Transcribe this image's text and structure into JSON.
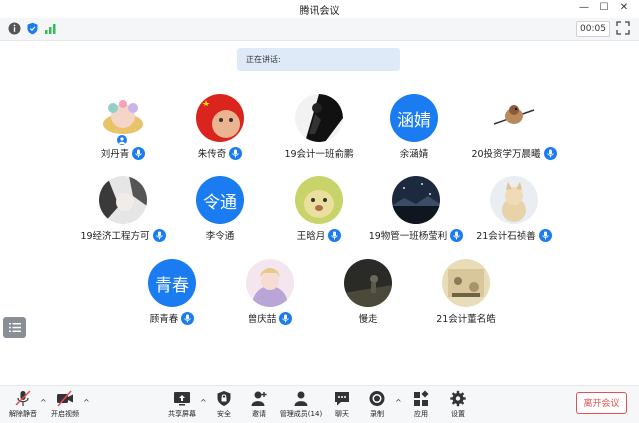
{
  "window": {
    "title": "腾讯会议",
    "minimize_glyph": "—",
    "maximize_glyph": "☐",
    "close_glyph": "✕"
  },
  "status": {
    "timer": "00:05",
    "speaking_label": "正在讲话:"
  },
  "colors": {
    "accent": "#1a7cf0",
    "leave_red": "#e94e4e",
    "speaking_bg": "#dfeaf8"
  },
  "participants": [
    {
      "name": "刘丹青",
      "avatar_type": "image",
      "host": true
    },
    {
      "name": "朱传奇",
      "avatar_type": "image",
      "host": false
    },
    {
      "name": "19会计一班俞鹏",
      "avatar_type": "image",
      "host": false
    },
    {
      "name": "余涵婧",
      "avatar_type": "text",
      "avatar_text": "涵婧",
      "host": false
    },
    {
      "name": "20投资学万晨曦",
      "avatar_type": "image",
      "host": false
    },
    {
      "name": "19经济工程方可",
      "avatar_type": "image",
      "host": false
    },
    {
      "name": "李令通",
      "avatar_type": "text",
      "avatar_text": "令通",
      "host": false
    },
    {
      "name": "王晗月",
      "avatar_type": "image",
      "host": false
    },
    {
      "name": "19物管一班杨莹利",
      "avatar_type": "image",
      "host": false
    },
    {
      "name": "21会计石祯善",
      "avatar_type": "image",
      "host": false
    },
    {
      "name": "顾青春",
      "avatar_type": "text",
      "avatar_text": "青春",
      "host": false
    },
    {
      "name": "曾庆喆",
      "avatar_type": "image",
      "host": false
    },
    {
      "name": "慢走",
      "avatar_type": "image",
      "host": false
    },
    {
      "name": "21会计董名皓",
      "avatar_type": "image",
      "host": false
    }
  ],
  "toolbar": {
    "unmute": "解除静音",
    "start_video": "开启视频",
    "share_screen": "共享屏幕",
    "security": "安全",
    "invite": "邀请",
    "manage_members": "管理成员(14)",
    "chat": "聊天",
    "record": "录制",
    "apps": "应用",
    "settings": "设置",
    "leave": "离开会议",
    "caret": "^"
  }
}
